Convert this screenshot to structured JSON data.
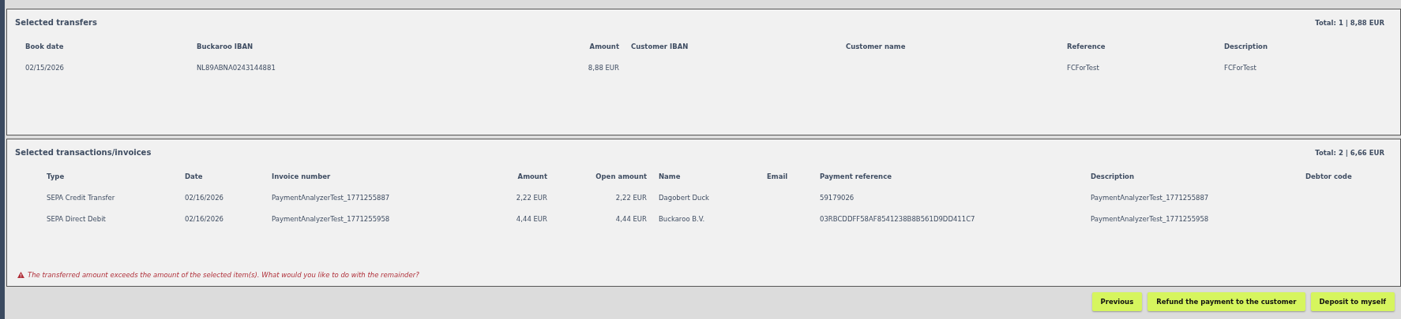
{
  "selected_transfers": {
    "title": "Selected transfers",
    "total": "Total: 1 | 8,88 EUR",
    "columns": [
      "Book date",
      "Buckaroo IBAN",
      "Amount",
      "Customer IBAN",
      "Customer name",
      "Reference",
      "Description"
    ],
    "rows": [
      [
        "02/15/2026",
        "NL89ABNA0243144881",
        "8,88 EUR",
        "",
        "",
        "FCForTest",
        "FCForTest"
      ]
    ]
  },
  "selected_transactions": {
    "title": "Selected transactions/invoices",
    "total": "Total: 2 | 6,66 EUR",
    "columns": [
      "Type",
      "Date",
      "Invoice number",
      "Amount",
      "Open amount",
      "Name",
      "Email",
      "Payment reference",
      "Description",
      "Debtor code"
    ],
    "rows": [
      [
        "SEPA Credit Transfer",
        "02/16/2026",
        "PaymentAnalyzerTest_1771255887",
        "2,22 EUR",
        "2,22 EUR",
        "Dagobert Duck",
        "",
        "59179026",
        "PaymentAnalyzerTest_1771255887",
        ""
      ],
      [
        "SEPA Direct Debit",
        "02/16/2026",
        "PaymentAnalyzerTest_1771255958",
        "4,44 EUR",
        "4,44 EUR",
        "Buckaroo B.V.",
        "",
        "03RBCDDFF58AF8541238B8B561D9DD411C7",
        "PaymentAnalyzerTest_1771255958",
        ""
      ]
    ],
    "warning": "The transferred amount exceeds the amount of the selected item(s). What would you like to do with the remainder?"
  },
  "buttons": [
    "Previous",
    "Refund the payment to the customer",
    "Deposit to myself"
  ]
}
